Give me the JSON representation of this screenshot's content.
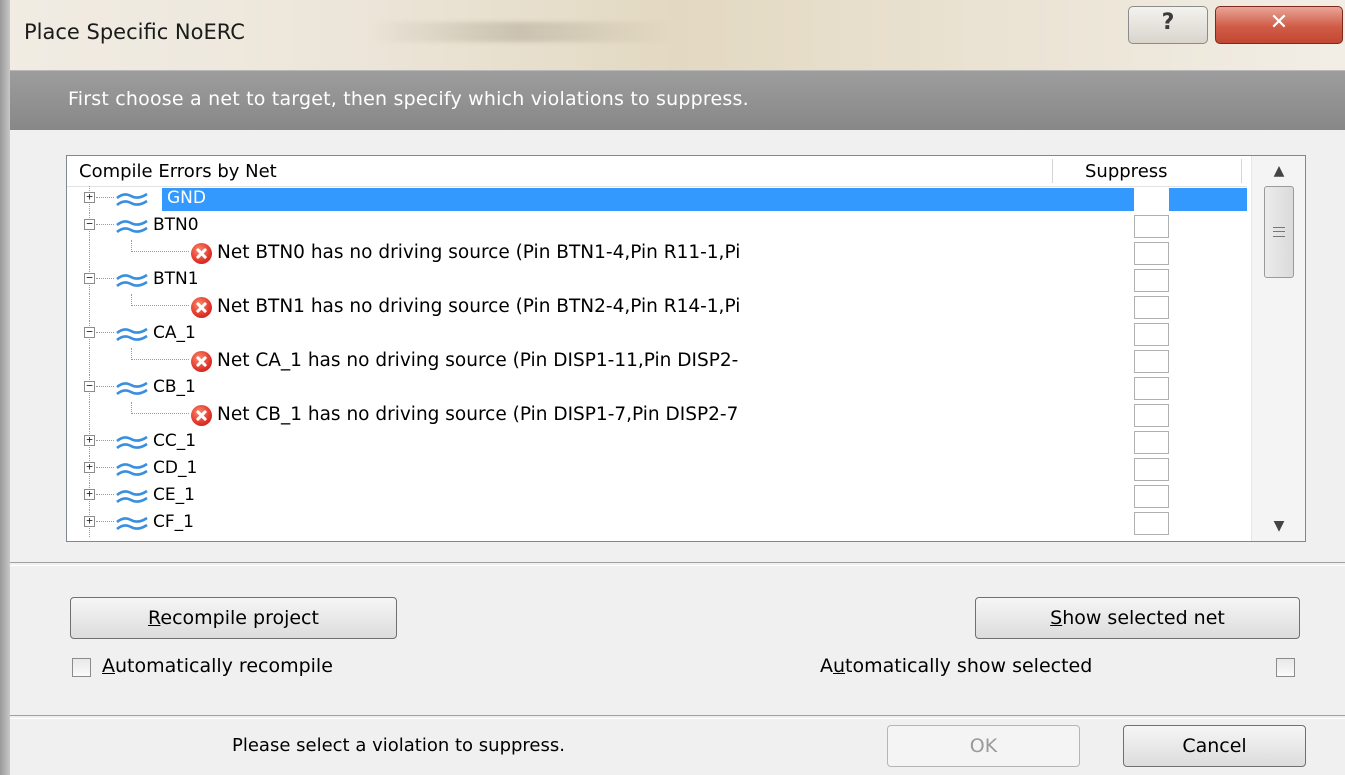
{
  "window": {
    "title": "Place Specific NoERC",
    "help_glyph": "?",
    "close_glyph": "✕"
  },
  "instructions": "First choose a net to target, then specify which violations to suppress.",
  "tree": {
    "col_net": "Compile Errors by Net",
    "col_suppress": "Suppress",
    "items": [
      {
        "type": "net",
        "label": "GND",
        "expanded": false,
        "selected": true,
        "checked": false
      },
      {
        "type": "net",
        "label": "BTN0",
        "expanded": true,
        "selected": false,
        "checked": false
      },
      {
        "type": "error",
        "text": "Net BTN0 has no driving source (Pin BTN1-4,Pin R11-1,Pi",
        "checked": false
      },
      {
        "type": "net",
        "label": "BTN1",
        "expanded": true,
        "selected": false,
        "checked": false
      },
      {
        "type": "error",
        "text": "Net BTN1 has no driving source (Pin BTN2-4,Pin R14-1,Pi",
        "checked": false
      },
      {
        "type": "net",
        "label": "CA_1",
        "expanded": true,
        "selected": false,
        "checked": false
      },
      {
        "type": "error",
        "text": "Net CA_1 has no driving source (Pin DISP1-11,Pin DISP2-",
        "checked": false
      },
      {
        "type": "net",
        "label": "CB_1",
        "expanded": true,
        "selected": false,
        "checked": false
      },
      {
        "type": "error",
        "text": "Net CB_1 has no driving source (Pin DISP1-7,Pin DISP2-7",
        "checked": false
      },
      {
        "type": "net",
        "label": "CC_1",
        "expanded": false,
        "selected": false,
        "checked": false
      },
      {
        "type": "net",
        "label": "CD_1",
        "expanded": false,
        "selected": false,
        "checked": false
      },
      {
        "type": "net",
        "label": "CE_1",
        "expanded": false,
        "selected": false,
        "checked": false
      },
      {
        "type": "net",
        "label": "CF_1",
        "expanded": false,
        "selected": false,
        "checked": false
      }
    ]
  },
  "buttons": {
    "recompile_pre": "",
    "recompile_u": "R",
    "recompile_post": "ecompile project",
    "show_pre": "",
    "show_u": "S",
    "show_post": "how selected net",
    "ok": "OK",
    "cancel": "Cancel"
  },
  "options": {
    "auto_recompile_pre": "",
    "auto_recompile_u": "A",
    "auto_recompile_post": "utomatically recompile",
    "auto_recompile_checked": false,
    "auto_show_pre": "A",
    "auto_show_u": "u",
    "auto_show_post": "tomatically show selected",
    "auto_show_checked": false
  },
  "status": "Please select a violation to suppress.",
  "colors": {
    "selection": "#3399ff",
    "net_icon": "#3a8fe0",
    "error_icon": "#e0342a",
    "close_button": "#cf5c47"
  }
}
